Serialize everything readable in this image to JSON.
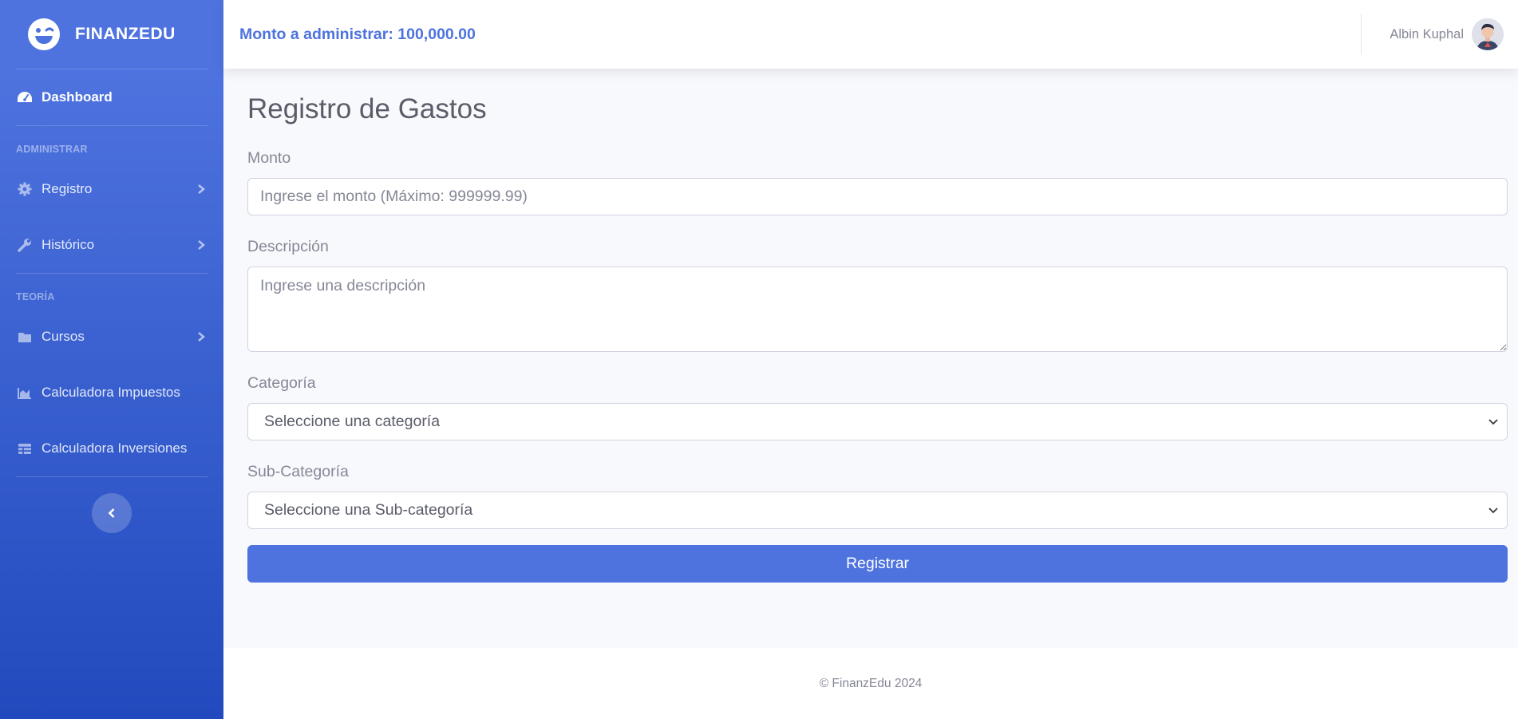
{
  "sidebar": {
    "brand": "FINANZEDU",
    "dashboard": "Dashboard",
    "heading_admin": "ADMINISTRAR",
    "registro": "Registro",
    "historico": "Histórico",
    "heading_teoria": "TEORÍA",
    "cursos": "Cursos",
    "calc_impuestos": "Calculadora Impuestos",
    "calc_inversiones": "Calculadora Inversiones"
  },
  "topbar": {
    "amount_text": "Monto a administrar: 100,000.00",
    "username": "Albin Kuphal"
  },
  "form": {
    "title": "Registro de Gastos",
    "monto_label": "Monto",
    "monto_placeholder": "Ingrese el monto (Máximo: 999999.99)",
    "descripcion_label": "Descripción",
    "descripcion_placeholder": "Ingrese una descripción",
    "categoria_label": "Categoría",
    "categoria_value": "Seleccione una categoría",
    "subcategoria_label": "Sub-Categoría",
    "subcategoria_value": "Seleccione una Sub-categoría",
    "submit_label": "Registrar"
  },
  "footer": {
    "copyright": "© FinanzEdu 2024"
  },
  "colors": {
    "primary": "#4e73df",
    "sidebar_dark": "#224abe",
    "text_muted": "#858796"
  }
}
